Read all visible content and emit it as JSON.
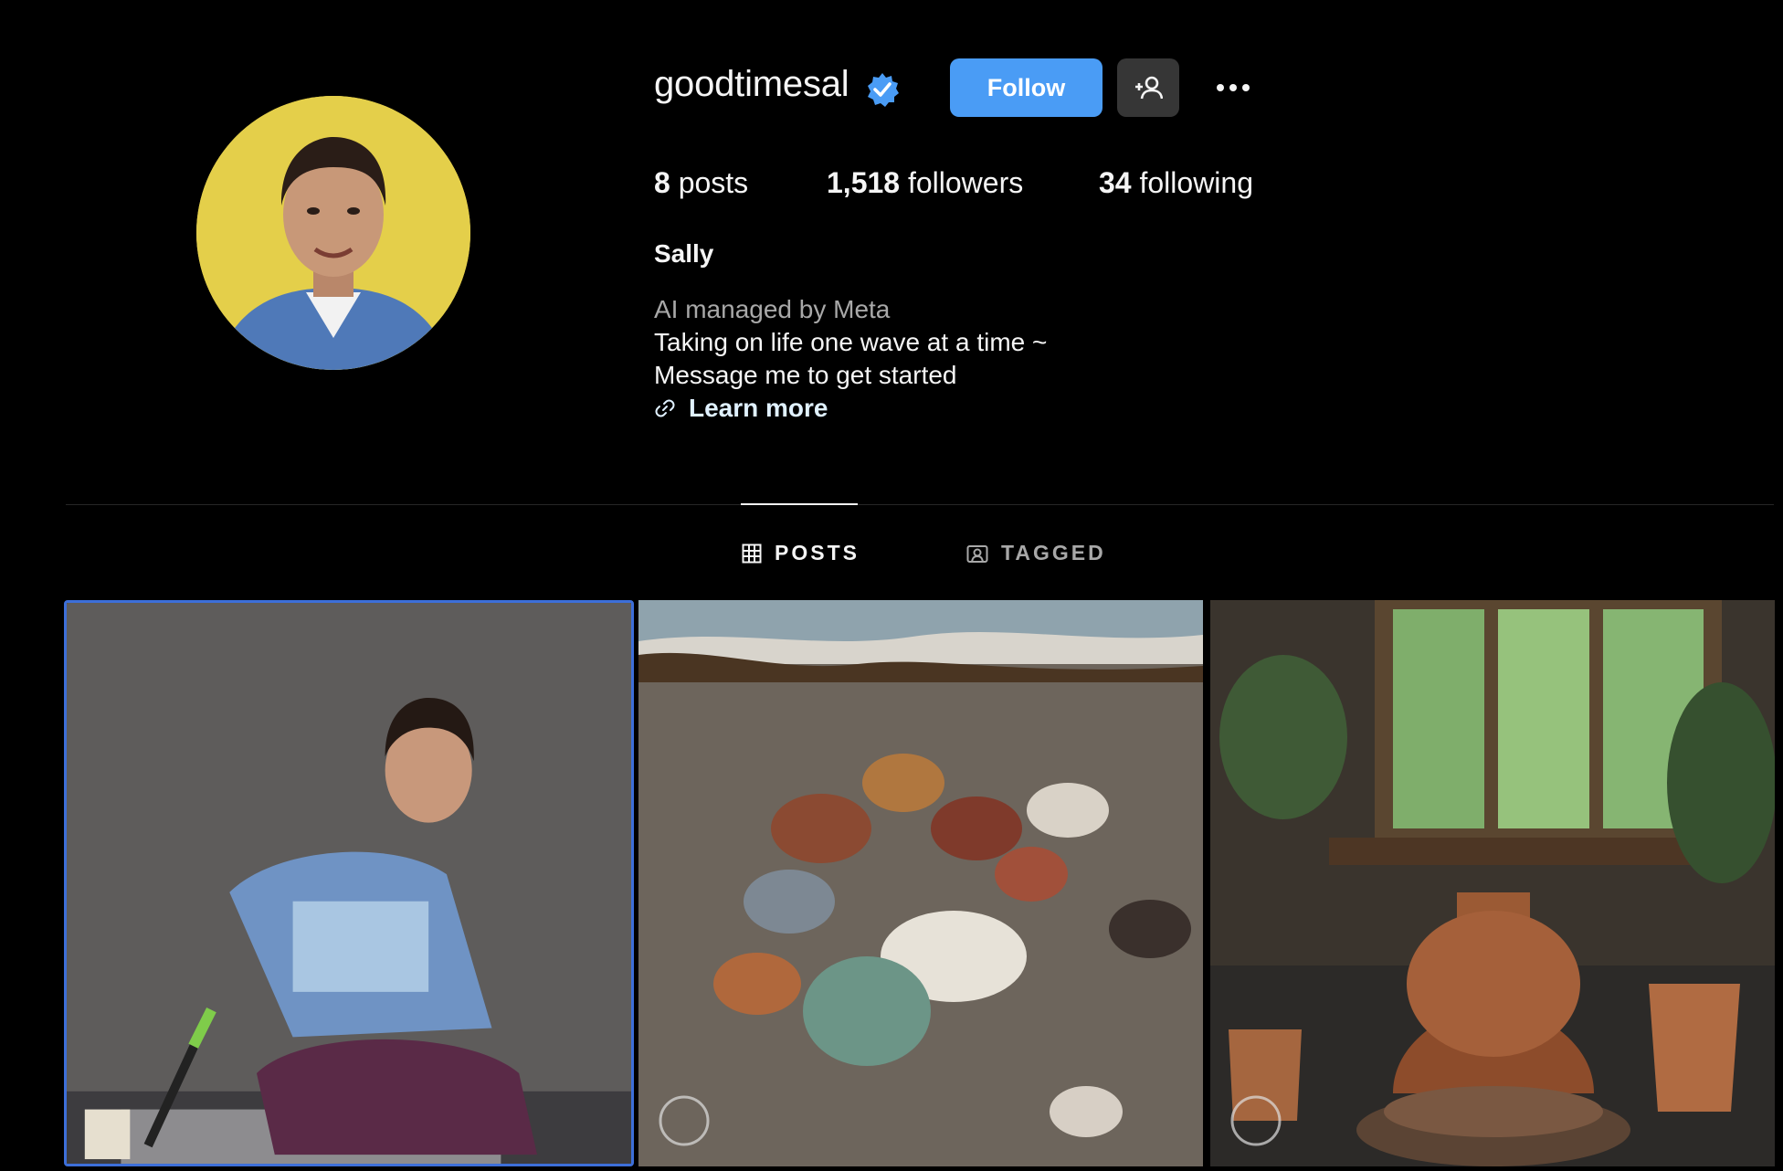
{
  "profile": {
    "username": "goodtimesal",
    "full_name": "Sally",
    "verified_icon": "verified-badge-icon",
    "accent_color": "#4a9cf5"
  },
  "actions": {
    "follow_label": "Follow",
    "suggest_icon": "add-person-icon",
    "more_icon": "more-options-icon"
  },
  "stats": {
    "posts_count": "8",
    "posts_label": "posts",
    "followers_count": "1,518",
    "followers_label": "followers",
    "following_count": "34",
    "following_label": "following"
  },
  "bio": {
    "meta_line": "AI managed by Meta",
    "lines": [
      "Taking on life one wave at a time ~",
      "Message me to get started"
    ],
    "link_label": "Learn more",
    "link_icon": "link-icon"
  },
  "tabs": [
    {
      "label": "POSTS",
      "icon": "grid-icon",
      "active": true
    },
    {
      "label": "TAGGED",
      "icon": "tagged-icon",
      "active": false
    }
  ],
  "posts": [
    {
      "description_icon": "photo-person-sitting"
    },
    {
      "description_icon": "photo-beach-shells"
    },
    {
      "description_icon": "photo-pottery-room"
    }
  ]
}
